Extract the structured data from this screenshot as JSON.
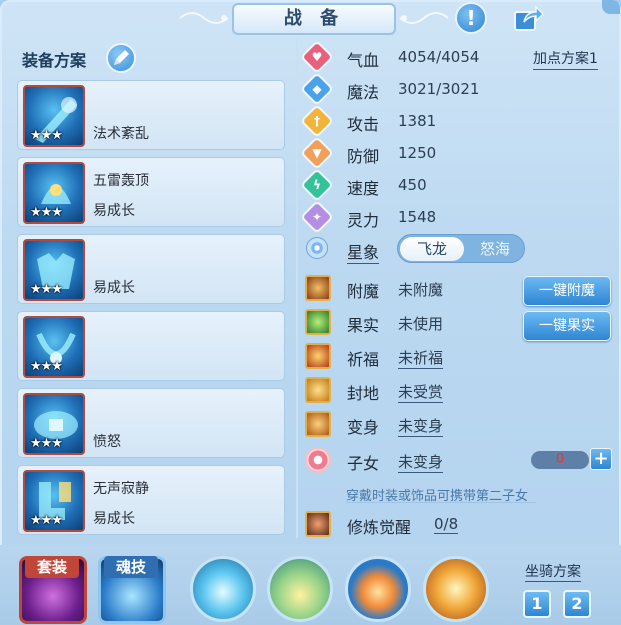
{
  "window": {
    "title": "战 备"
  },
  "left": {
    "title": "装备方案",
    "slots": [
      {
        "stars": "★★★",
        "line1": "",
        "line2": "法术紊乱"
      },
      {
        "stars": "★★★",
        "line1": "五雷轰顶",
        "line2": "易成长"
      },
      {
        "stars": "★★★",
        "line1": "",
        "line2": "易成长"
      },
      {
        "stars": "★★★",
        "line1": "",
        "line2": ""
      },
      {
        "stars": "★★★",
        "line1": "",
        "line2": "愤怒"
      },
      {
        "stars": "★★★",
        "line1": "无声寂静",
        "line2": "易成长"
      }
    ]
  },
  "stats": [
    {
      "label": "气血",
      "value": "4054/4054",
      "icon": "heart-icon",
      "color": "#e8607a"
    },
    {
      "label": "魔法",
      "value": "3021/3021",
      "icon": "mana-icon",
      "color": "#4aa3ea"
    },
    {
      "label": "攻击",
      "value": "1381",
      "icon": "sword-icon",
      "color": "#f2b43a"
    },
    {
      "label": "防御",
      "value": "1250",
      "icon": "shield-icon",
      "color": "#f0a05a"
    },
    {
      "label": "速度",
      "value": "450",
      "icon": "speed-icon",
      "color": "#33c39a"
    },
    {
      "label": "灵力",
      "value": "1548",
      "icon": "spirit-icon",
      "color": "#b48ee4"
    }
  ],
  "add_point": "加点方案1",
  "xingxiang": {
    "label": "星象",
    "option_on": "飞龙",
    "option_off": "怒海"
  },
  "features": [
    {
      "label": "附魔",
      "value": "未附魔",
      "underlined": false
    },
    {
      "label": "果实",
      "value": "未使用",
      "underlined": false
    },
    {
      "label": "祈福",
      "value": "未祈福",
      "underlined": true
    },
    {
      "label": "封地",
      "value": "未受赏",
      "underlined": true
    },
    {
      "label": "变身",
      "value": "未变身",
      "underlined": true
    },
    {
      "label": "子女",
      "value": "未变身",
      "underlined": true
    }
  ],
  "buttons": {
    "enchant": "一键附魔",
    "fruit": "一键果实"
  },
  "child": {
    "count": "0",
    "plus": "+"
  },
  "hint": "穿戴时装或饰品可携带第二子女",
  "cultivation": {
    "label": "修炼觉醒",
    "value": "0/8"
  },
  "bottom": {
    "set_tag": "套装",
    "soul_tag": "魂技",
    "mount_title": "坐骑方案",
    "mount_options": [
      "1",
      "2"
    ]
  },
  "colors": {
    "accent": "#2e86d2",
    "panel": "#cfe4f6",
    "child_count": "#e03a3a"
  }
}
